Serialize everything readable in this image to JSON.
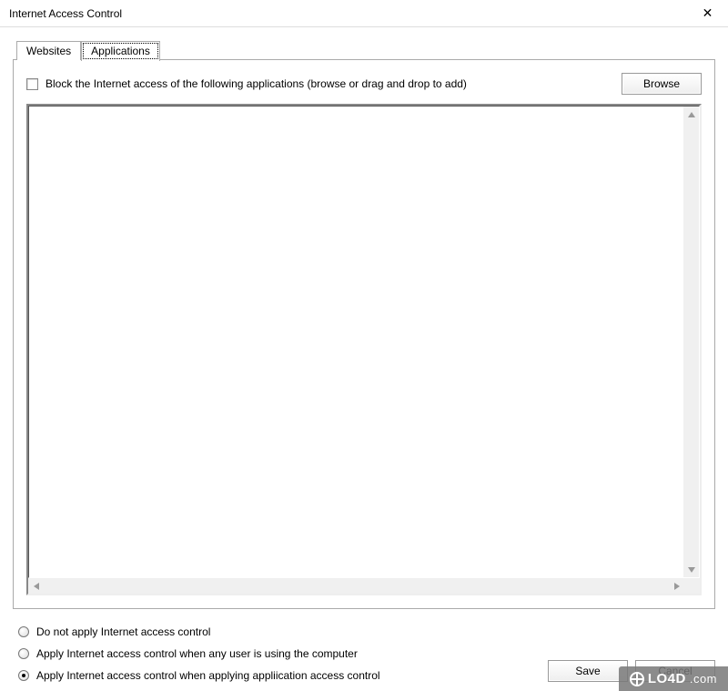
{
  "window": {
    "title": "Internet Access Control"
  },
  "tabs": {
    "websites": {
      "label": "Websites"
    },
    "applications": {
      "label": "Applications"
    },
    "active": "applications"
  },
  "panel": {
    "block_checkbox_label": "Block the Internet access of the following applications (browse or drag and drop to add)",
    "browse_button": "Browse"
  },
  "radios": {
    "none": {
      "label": "Do not apply Internet access control"
    },
    "any_user": {
      "label": "Apply Internet access control when any user is using the computer"
    },
    "app_access": {
      "label": "Apply Internet access control when applying appliication access control"
    },
    "selected": "app_access"
  },
  "buttons": {
    "save": "Save",
    "cancel": "Cancel"
  },
  "watermark": {
    "text": "LO4D",
    "suffix": ".com"
  }
}
